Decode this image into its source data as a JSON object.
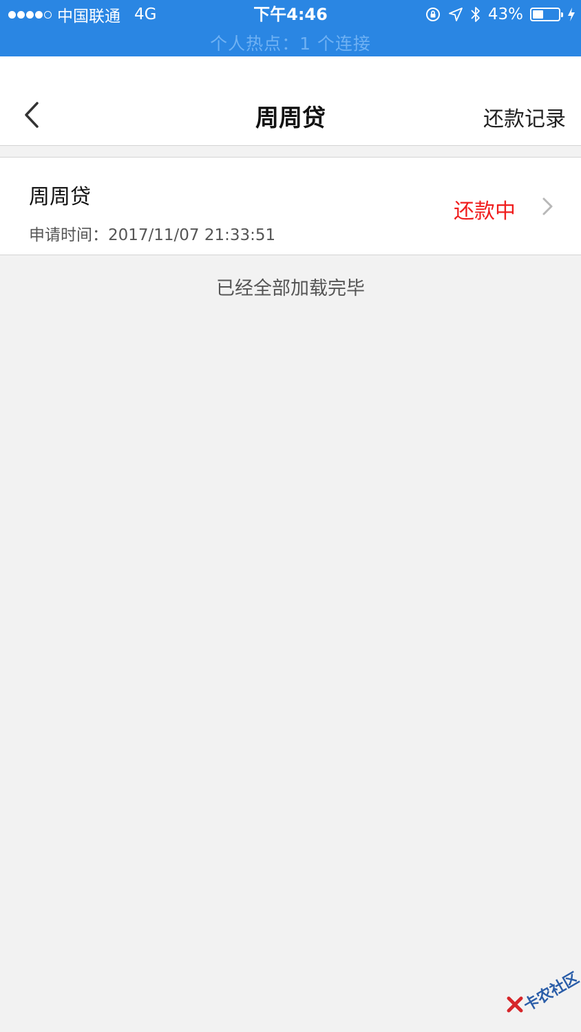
{
  "status_bar": {
    "carrier": "中国联通",
    "network": "4G",
    "time": "下午4:46",
    "battery_percent": "43%",
    "battery_level": 0.43,
    "hotspot_text": "个人热点：1 个连接",
    "signal_bars_filled": 4,
    "signal_bars_total": 5,
    "bar_color": "#2a86e3"
  },
  "navbar": {
    "title": "周周贷",
    "right_label": "还款记录"
  },
  "loan_item": {
    "title": "周周贷",
    "apply_time": "申请时间：2017/11/07 21:33:51",
    "status": "还款中",
    "status_color": "#f01d1d"
  },
  "list_footer": {
    "text": "已经全部加载完毕"
  },
  "watermark": {
    "text": "卡农社区"
  }
}
